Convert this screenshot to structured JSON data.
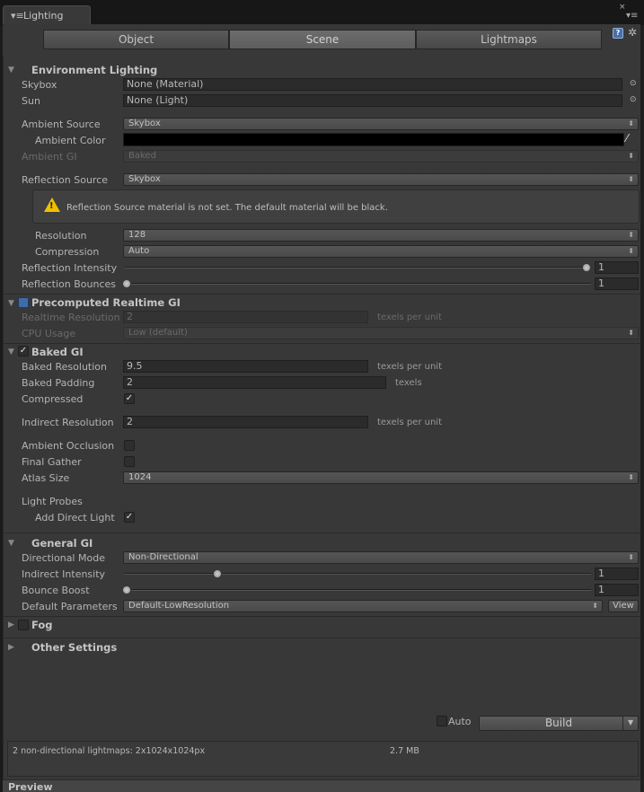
{
  "window": {
    "tab_title": "Lighting",
    "tab_icon": "menu-icon",
    "close_glyph": "×",
    "menu_glyph": "▾≡"
  },
  "tabs": [
    {
      "label": "Object",
      "active": false
    },
    {
      "label": "Scene",
      "active": true
    },
    {
      "label": "Lightmaps",
      "active": false
    }
  ],
  "toolbar": {
    "help_glyph": "?",
    "gear_glyph": "✲"
  },
  "env": {
    "title": "Environment Lighting",
    "skybox": {
      "label": "Skybox",
      "value": "None (Material)"
    },
    "sun": {
      "label": "Sun",
      "value": "None (Light)"
    },
    "ambient_source": {
      "label": "Ambient Source",
      "value": "Skybox"
    },
    "ambient_color": {
      "label": "Ambient Color",
      "color": "#000000"
    },
    "ambient_gi": {
      "label": "Ambient GI",
      "value": "Baked"
    },
    "reflection_source": {
      "label": "Reflection Source",
      "value": "Skybox"
    },
    "warning": "Reflection Source material is not set. The default material will be black.",
    "resolution": {
      "label": "Resolution",
      "value": "128"
    },
    "compression": {
      "label": "Compression",
      "value": "Auto"
    },
    "reflection_intensity": {
      "label": "Reflection Intensity",
      "value": "1",
      "min": 0,
      "max": 1
    },
    "reflection_bounces": {
      "label": "Reflection Bounces",
      "value": "1",
      "min": 1,
      "max": 5
    }
  },
  "realtime": {
    "title": "Precomputed Realtime GI",
    "enabled": false,
    "resolution": {
      "label": "Realtime Resolution",
      "value": "2",
      "unit": "texels per unit"
    },
    "cpu_usage": {
      "label": "CPU Usage",
      "value": "Low (default)"
    }
  },
  "baked": {
    "title": "Baked GI",
    "enabled": true,
    "resolution": {
      "label": "Baked Resolution",
      "value": "9.5",
      "unit": "texels per unit"
    },
    "padding": {
      "label": "Baked Padding",
      "value": "2",
      "unit": "texels"
    },
    "compressed": {
      "label": "Compressed",
      "checked": true
    },
    "indirect_resolution": {
      "label": "Indirect Resolution",
      "value": "2",
      "unit": "texels per unit"
    },
    "ambient_occlusion": {
      "label": "Ambient Occlusion",
      "checked": false
    },
    "final_gather": {
      "label": "Final Gather",
      "checked": false
    },
    "atlas_size": {
      "label": "Atlas Size",
      "value": "1024"
    },
    "light_probes": {
      "label": "Light Probes"
    },
    "add_direct_light": {
      "label": "Add Direct Light",
      "checked": true
    }
  },
  "general": {
    "title": "General GI",
    "directional_mode": {
      "label": "Directional Mode",
      "value": "Non-Directional"
    },
    "indirect_intensity": {
      "label": "Indirect Intensity",
      "value": "1",
      "min": 0,
      "max": 5
    },
    "bounce_boost": {
      "label": "Bounce Boost",
      "value": "1",
      "min": 1,
      "max": 10
    },
    "default_parameters": {
      "label": "Default Parameters",
      "value": "Default-LowResolution",
      "view_label": "View"
    }
  },
  "fog": {
    "title": "Fog",
    "enabled": false
  },
  "other": {
    "title": "Other Settings"
  },
  "build": {
    "auto_label": "Auto",
    "auto_checked": false,
    "build_label": "Build"
  },
  "info": {
    "summary": "2 non-directional lightmaps: 2x1024x1024px",
    "size": "2.7 MB"
  },
  "preview": {
    "label": "Preview"
  },
  "glyphs": {
    "check": "✓",
    "picker": "⊙",
    "arrows": "⬍",
    "fold_open": "▼",
    "fold_closed": "▶",
    "warn_bang": "!",
    "eyedropper": "⁄"
  },
  "colors": {
    "accent_check": "#3f6ba8",
    "warning": "#f0c000"
  }
}
